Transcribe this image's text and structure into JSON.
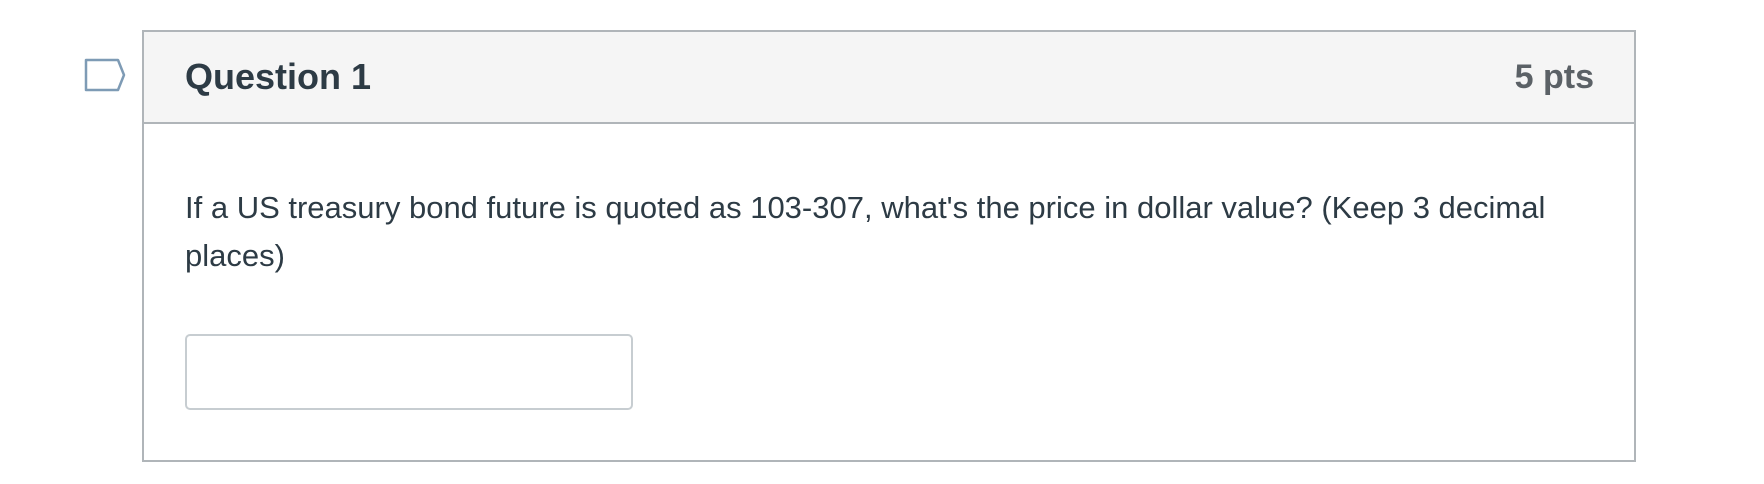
{
  "question": {
    "flag_icon": "bookmark-flag-icon",
    "title": "Question 1",
    "points": "5 pts",
    "text": "If a US treasury bond future is quoted as 103-307, what's the price in dollar value? (Keep 3 decimal places)",
    "answer": {
      "value": "",
      "placeholder": ""
    }
  },
  "colors": {
    "header_bg": "#f5f5f5",
    "border": "#b0b5b9",
    "text": "#2d3b45",
    "points_text": "#5b6166",
    "flag_stroke": "#7e9bb5"
  }
}
